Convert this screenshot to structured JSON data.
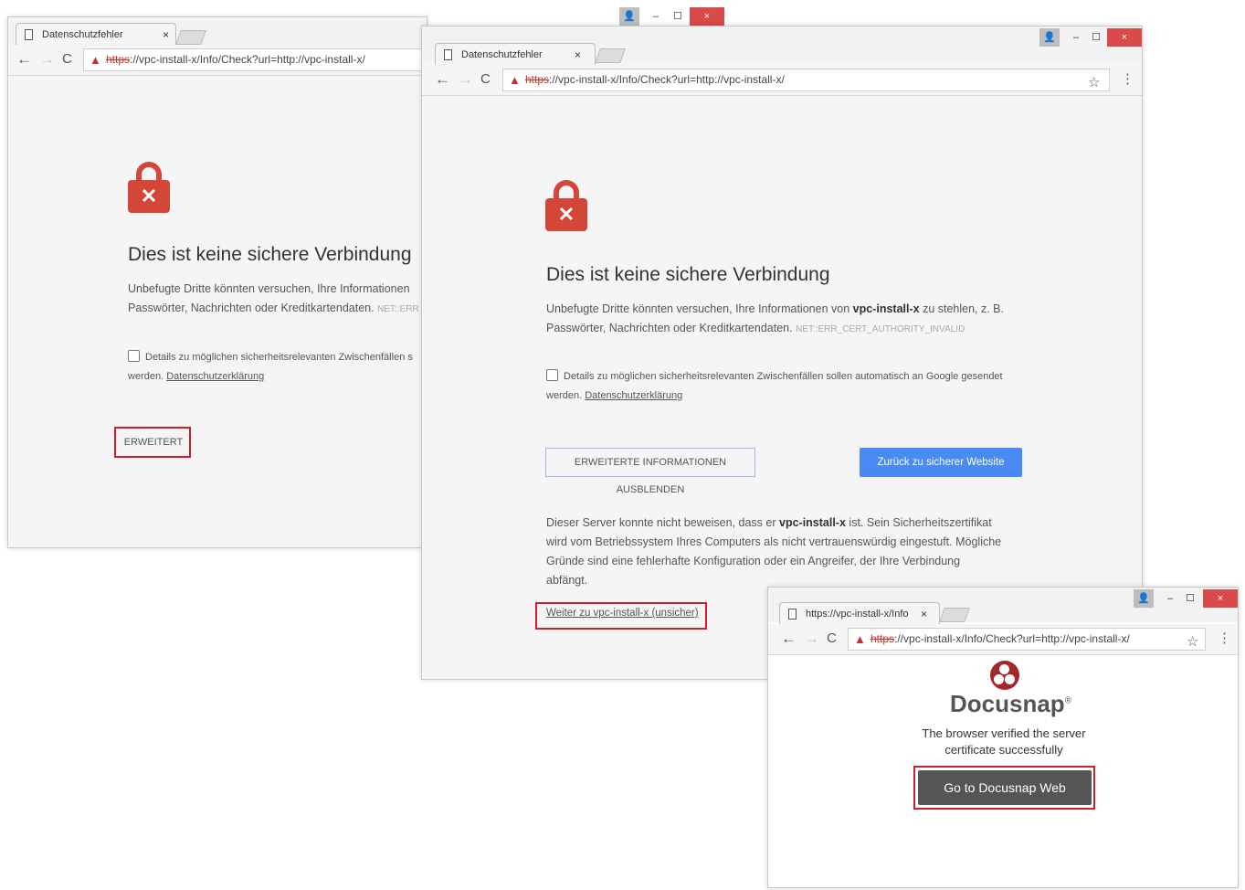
{
  "window1": {
    "tab_title": "Datenschutzfehler",
    "tab_close": "×",
    "url_scheme": "https",
    "url_rest": "://vpc-install-x/Info/Check?url=http://vpc-install-x/",
    "heading": "Dies ist keine sichere Verbindung",
    "para_line1": "Unbefugte Dritte könnten versuchen, Ihre Informationen",
    "para_line2": "Passwörter, Nachrichten oder Kreditkartendaten.",
    "error_code": "NET::ERR",
    "checkbox_label": "Details zu möglichen sicherheitsrelevanten Zwischenfällen s",
    "checkbox_line2": "werden.",
    "privacy_link": "Datenschutzerklärung",
    "advanced_button": "ERWEITERT"
  },
  "window2": {
    "tab_title": "Datenschutzfehler",
    "tab_close": "×",
    "url_scheme": "https",
    "url_rest": "://vpc-install-x/Info/Check?url=http://vpc-install-x/",
    "heading": "Dies ist keine sichere Verbindung",
    "para_pre": "Unbefugte Dritte könnten versuchen, Ihre Informationen von",
    "para_bold": "vpc-install-x",
    "para_post": "zu stehlen, z. B.",
    "para_line2": "Passwörter, Nachrichten oder Kreditkartendaten.",
    "error_code": "NET::ERR_CERT_AUTHORITY_INVALID",
    "checkbox_label": "Details zu möglichen sicherheitsrelevanten Zwischenfällen sollen automatisch an Google gesendet",
    "checkbox_line2": "werden.",
    "privacy_link": "Datenschutzerklärung",
    "hide_advanced_button": "ERWEITERTE INFORMATIONEN AUSBLENDEN",
    "back_button": "Zurück zu sicherer Website",
    "explain_pre": "Dieser Server konnte nicht beweisen, dass er",
    "explain_bold": "vpc-install-x",
    "explain_post": "ist. Sein Sicherheitszertifikat",
    "explain_line2": "wird vom Betriebssystem Ihres Computers als nicht vertrauenswürdig eingestuft. Mögliche",
    "explain_line3": "Gründe sind eine fehlerhafte Konfiguration oder ein Angreifer, der Ihre Verbindung",
    "explain_line4": "abfängt.",
    "proceed_link": "Weiter zu vpc-install-x (unsicher)"
  },
  "window3": {
    "tab_title": "https://vpc-install-x/Info",
    "tab_close": "×",
    "url_scheme": "https",
    "url_rest": "://vpc-install-x/Info/Check?url=http://vpc-install-x/",
    "brand": "Docusnap",
    "trademark": "®",
    "verified_line1": "The browser verified the server",
    "verified_line2": "certificate successfully",
    "go_button": "Go to Docusnap Web"
  },
  "controls": {
    "minimize": "–",
    "maximize": "☐",
    "close": "×",
    "user": "👤",
    "back": "←",
    "forward": "→",
    "reload": "C",
    "star": "☆",
    "menu": "⋮",
    "warning": "▲",
    "lock_x": "✕"
  },
  "colors": {
    "danger": "#d44638",
    "highlight_box": "#cc1f2a",
    "primary_button": "#4a8af4",
    "docusnap_red": "#a3272b",
    "close_button": "#d94a4a"
  }
}
